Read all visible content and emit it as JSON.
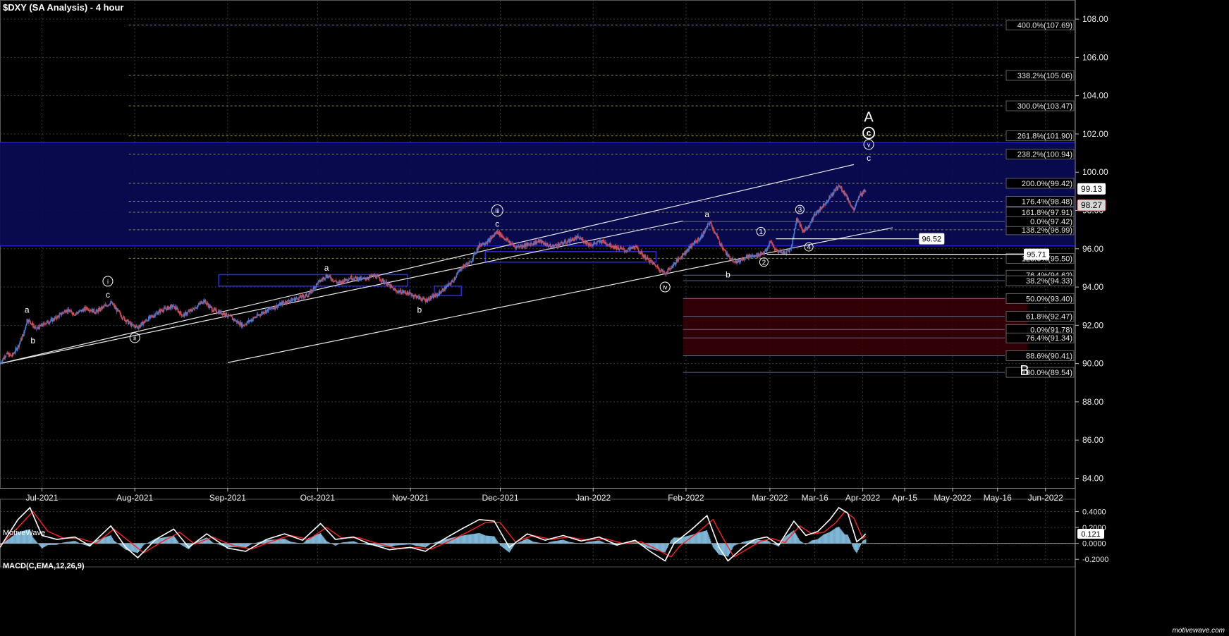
{
  "chart_title": "$DXY (SA Analysis) - 4 hour",
  "brand_label": "MotiveWave",
  "site_label": "motivewave.com",
  "macd_label": "MACD(C,EMA,12,26,9)",
  "colors": {
    "background": "#000000",
    "grid": "#3a3a3a",
    "fib_line": "#8f8f3a",
    "fib_line_lower": "#5a6a8a",
    "channel": "#e8e8e8",
    "zone_blue": "#0a0a55",
    "zone_red": "#3a0008",
    "bull_candle": "#4a7ad8",
    "bear_candle": "#e04848",
    "macd_line": "#ffffff",
    "signal_line": "#ff2020",
    "histogram": "#7fb8d8"
  },
  "chart_data": {
    "type": "candlestick",
    "title": "$DXY (SA Analysis) - 4 hour",
    "ylim": [
      83.5,
      109.0
    ],
    "x_date_range": [
      "2021-06-17",
      "2022-06-10"
    ],
    "x_ticks": [
      {
        "label": "Jul-2021",
        "date": "2021-07-01"
      },
      {
        "label": "Aug-2021",
        "date": "2021-08-01"
      },
      {
        "label": "Sep-2021",
        "date": "2021-09-01"
      },
      {
        "label": "Oct-2021",
        "date": "2021-10-01"
      },
      {
        "label": "Nov-2021",
        "date": "2021-11-01"
      },
      {
        "label": "Dec-2021",
        "date": "2021-12-01"
      },
      {
        "label": "Jan-2022",
        "date": "2022-01-01"
      },
      {
        "label": "Feb-2022",
        "date": "2022-02-01"
      },
      {
        "label": "Mar-2022",
        "date": "2022-03-01"
      },
      {
        "label": "Mar-16",
        "date": "2022-03-16"
      },
      {
        "label": "Apr-2022",
        "date": "2022-04-01"
      },
      {
        "label": "Apr-15",
        "date": "2022-04-15"
      },
      {
        "label": "May-2022",
        "date": "2022-05-01"
      },
      {
        "label": "May-16",
        "date": "2022-05-16"
      },
      {
        "label": "Jun-2022",
        "date": "2022-06-01"
      }
    ],
    "y_ticks": [
      "84.00",
      "86.00",
      "88.00",
      "90.00",
      "92.00",
      "94.00",
      "96.00",
      "98.00",
      "100.00",
      "102.00",
      "104.00",
      "106.00",
      "108.00"
    ],
    "price_path": [
      [
        "2021-06-17",
        90.0
      ],
      [
        "2021-06-19",
        90.5
      ],
      [
        "2021-06-21",
        90.4
      ],
      [
        "2021-06-23",
        90.9
      ],
      [
        "2021-06-25",
        91.6
      ],
      [
        "2021-06-26",
        92.3
      ],
      [
        "2021-06-27",
        92.2
      ],
      [
        "2021-06-29",
        91.8
      ],
      [
        "2021-07-02",
        92.1
      ],
      [
        "2021-07-06",
        92.4
      ],
      [
        "2021-07-09",
        92.8
      ],
      [
        "2021-07-12",
        92.6
      ],
      [
        "2021-07-16",
        92.9
      ],
      [
        "2021-07-19",
        92.7
      ],
      [
        "2021-07-22",
        93.0
      ],
      [
        "2021-07-24",
        93.2
      ],
      [
        "2021-07-28",
        92.4
      ],
      [
        "2021-07-31",
        92.0
      ],
      [
        "2021-08-02",
        91.9
      ],
      [
        "2021-08-06",
        92.4
      ],
      [
        "2021-08-10",
        92.8
      ],
      [
        "2021-08-14",
        93.0
      ],
      [
        "2021-08-17",
        92.5
      ],
      [
        "2021-08-21",
        92.9
      ],
      [
        "2021-08-24",
        93.3
      ],
      [
        "2021-08-27",
        92.8
      ],
      [
        "2021-08-31",
        92.6
      ],
      [
        "2021-09-03",
        92.3
      ],
      [
        "2021-09-06",
        92.0
      ],
      [
        "2021-09-09",
        92.3
      ],
      [
        "2021-09-13",
        92.7
      ],
      [
        "2021-09-16",
        92.9
      ],
      [
        "2021-09-20",
        93.2
      ],
      [
        "2021-09-24",
        93.4
      ],
      [
        "2021-09-28",
        93.6
      ],
      [
        "2021-10-01",
        94.2
      ],
      [
        "2021-10-04",
        94.6
      ],
      [
        "2021-10-08",
        94.2
      ],
      [
        "2021-10-12",
        94.5
      ],
      [
        "2021-10-16",
        94.4
      ],
      [
        "2021-10-20",
        94.6
      ],
      [
        "2021-10-24",
        94.2
      ],
      [
        "2021-10-27",
        93.8
      ],
      [
        "2021-10-31",
        93.7
      ],
      [
        "2021-11-03",
        93.5
      ],
      [
        "2021-11-06",
        93.3
      ],
      [
        "2021-11-10",
        93.6
      ],
      [
        "2021-11-13",
        94.0
      ],
      [
        "2021-11-15",
        94.3
      ],
      [
        "2021-11-18",
        95.0
      ],
      [
        "2021-11-21",
        95.3
      ],
      [
        "2021-11-24",
        96.2
      ],
      [
        "2021-11-27",
        96.4
      ],
      [
        "2021-11-30",
        96.9
      ],
      [
        "2021-12-02",
        96.6
      ],
      [
        "2021-12-06",
        96.1
      ],
      [
        "2021-12-10",
        96.2
      ],
      [
        "2021-12-14",
        96.4
      ],
      [
        "2021-12-18",
        96.1
      ],
      [
        "2021-12-22",
        96.3
      ],
      [
        "2021-12-27",
        96.6
      ],
      [
        "2021-12-31",
        96.2
      ],
      [
        "2022-01-04",
        96.4
      ],
      [
        "2022-01-08",
        96.1
      ],
      [
        "2022-01-12",
        95.9
      ],
      [
        "2022-01-15",
        96.1
      ],
      [
        "2022-01-18",
        95.6
      ],
      [
        "2022-01-22",
        95.1
      ],
      [
        "2022-01-25",
        94.7
      ],
      [
        "2022-01-28",
        95.2
      ],
      [
        "2022-01-31",
        95.7
      ],
      [
        "2022-02-03",
        96.2
      ],
      [
        "2022-02-06",
        96.6
      ],
      [
        "2022-02-09",
        97.4
      ],
      [
        "2022-02-12",
        96.4
      ],
      [
        "2022-02-15",
        95.6
      ],
      [
        "2022-02-18",
        95.3
      ],
      [
        "2022-02-21",
        95.6
      ],
      [
        "2022-02-24",
        95.6
      ],
      [
        "2022-02-28",
        95.9
      ],
      [
        "2022-03-01",
        96.4
      ],
      [
        "2022-03-03",
        95.9
      ],
      [
        "2022-03-06",
        95.8
      ],
      [
        "2022-03-08",
        96.0
      ],
      [
        "2022-03-10",
        97.6
      ],
      [
        "2022-03-12",
        96.9
      ],
      [
        "2022-03-14",
        97.2
      ],
      [
        "2022-03-16",
        97.8
      ],
      [
        "2022-03-19",
        98.3
      ],
      [
        "2022-03-22",
        98.9
      ],
      [
        "2022-03-24",
        99.3
      ],
      [
        "2022-03-26",
        98.9
      ],
      [
        "2022-03-29",
        98.0
      ],
      [
        "2022-03-31",
        98.8
      ],
      [
        "2022-04-02",
        99.13
      ]
    ],
    "fib_levels_upper": [
      {
        "label": "400.0%(107.69)",
        "value": 107.69
      },
      {
        "label": "338.2%(105.06)",
        "value": 105.06
      },
      {
        "label": "300.0%(103.47)",
        "value": 103.47
      },
      {
        "label": "261.8%(101.90)",
        "value": 101.9
      },
      {
        "label": "238.2%(100.94)",
        "value": 100.94
      },
      {
        "label": "200.0%(99.42)",
        "value": 99.42
      },
      {
        "label": "176.4%(98.48)",
        "value": 98.48
      },
      {
        "label": "161.8%(97.91)",
        "value": 97.91
      },
      {
        "label": "138.2%(96.99)",
        "value": 96.99
      },
      {
        "label": "123.6%(95.50)",
        "value": 95.5
      }
    ],
    "fib_levels_lower": [
      {
        "label": "0.0%(97.42)",
        "value": 97.42
      },
      {
        "label": "76.4%(94.62)",
        "value": 94.62
      },
      {
        "label": "38.2%(94.33)",
        "value": 94.33
      },
      {
        "label": "50.0%(93.40)",
        "value": 93.4
      },
      {
        "label": "61.8%(92.47)",
        "value": 92.47
      },
      {
        "label": "0.0%(91.78)",
        "value": 91.78
      },
      {
        "label": "76.4%(91.34)",
        "value": 91.34
      },
      {
        "label": "88.6%(90.41)",
        "value": 90.41
      },
      {
        "label": "100.0%(89.54)",
        "value": 89.54
      }
    ],
    "price_markers": [
      {
        "label": "99.13",
        "value": 99.13,
        "style": "current"
      },
      {
        "label": "98.27",
        "value": 98.27,
        "style": "last"
      }
    ],
    "support_lines": [
      {
        "label": "96.52",
        "value": 96.52,
        "from": "2022-03-03",
        "to": "2022-04-20"
      },
      {
        "label": "95.71",
        "value": 95.71,
        "from": "2022-02-28",
        "to": "2022-05-25"
      }
    ],
    "zones": [
      {
        "kind": "blue",
        "top": 101.55,
        "bottom": 96.15,
        "from": "2021-06-17",
        "to": "2022-06-28"
      },
      {
        "kind": "red",
        "top": 93.45,
        "bottom": 90.45,
        "from": "2022-01-31",
        "to": "2022-05-26"
      }
    ],
    "boxes": [
      {
        "top": 94.65,
        "bottom": 94.05,
        "from": "2021-08-29",
        "to": "2021-10-31"
      },
      {
        "top": 94.05,
        "bottom": 93.55,
        "from": "2021-11-09",
        "to": "2021-11-18"
      },
      {
        "top": 95.85,
        "bottom": 95.3,
        "from": "2021-11-26",
        "to": "2022-01-22"
      }
    ],
    "channels": [
      {
        "from": [
          "2021-06-17",
          90.0
        ],
        "to": [
          "2022-03-29",
          100.4
        ]
      },
      {
        "from": [
          "2021-06-17",
          90.0
        ],
        "to": [
          "2022-01-31",
          97.45
        ]
      },
      {
        "from": [
          "2021-09-01",
          90.05
        ],
        "to": [
          "2022-04-11",
          97.1
        ]
      }
    ],
    "wave_labels": [
      {
        "text": "a",
        "date": "2021-06-26",
        "value": 92.8,
        "style": "plain"
      },
      {
        "text": "b",
        "date": "2021-06-28",
        "value": 91.2,
        "style": "plain"
      },
      {
        "text": "i",
        "date": "2021-07-23",
        "value": 94.3,
        "style": "roman-circle"
      },
      {
        "text": "c",
        "date": "2021-07-23",
        "value": 93.6,
        "style": "plain"
      },
      {
        "text": "ii",
        "date": "2021-08-01",
        "value": 91.35,
        "style": "roman-circle"
      },
      {
        "text": "a",
        "date": "2021-10-04",
        "value": 95.0,
        "style": "plain"
      },
      {
        "text": "b",
        "date": "2021-11-04",
        "value": 92.8,
        "style": "plain"
      },
      {
        "text": "iii",
        "date": "2021-11-30",
        "value": 98.0,
        "style": "roman-circle"
      },
      {
        "text": "c",
        "date": "2021-11-30",
        "value": 97.3,
        "style": "plain"
      },
      {
        "text": "iv",
        "date": "2022-01-25",
        "value": 94.0,
        "style": "roman-circle"
      },
      {
        "text": "a",
        "date": "2022-02-08",
        "value": 97.8,
        "style": "plain"
      },
      {
        "text": "b",
        "date": "2022-02-15",
        "value": 94.65,
        "style": "plain"
      },
      {
        "text": "1",
        "date": "2022-02-26",
        "value": 96.9,
        "style": "circle"
      },
      {
        "text": "2",
        "date": "2022-02-27",
        "value": 95.3,
        "style": "circle"
      },
      {
        "text": "3",
        "date": "2022-03-11",
        "value": 98.05,
        "style": "circle"
      },
      {
        "text": "4",
        "date": "2022-03-14",
        "value": 96.1,
        "style": "circle"
      },
      {
        "text": "A",
        "date": "2022-04-03",
        "value": 102.9,
        "style": "large"
      },
      {
        "text": "c",
        "date": "2022-04-03",
        "value": 102.05,
        "style": "circle-bold"
      },
      {
        "text": "v",
        "date": "2022-04-03",
        "value": 101.45,
        "style": "roman-circle"
      },
      {
        "text": "c",
        "date": "2022-04-03",
        "value": 100.75,
        "style": "plain"
      },
      {
        "text": "B",
        "date": "2022-05-25",
        "value": 89.65,
        "style": "large"
      }
    ]
  },
  "macd_data": {
    "ylim": [
      -0.26,
      0.52
    ],
    "y_ticks": [
      {
        "label": "0.4000",
        "value": 0.4
      },
      {
        "label": "0.2000",
        "value": 0.2
      },
      {
        "label": "0.0000",
        "value": 0.0
      },
      {
        "label": "-0.2000",
        "value": -0.2
      }
    ],
    "current": {
      "label": "0.121",
      "value": 0.121
    },
    "macd": [
      [
        "2021-06-17",
        -0.05
      ],
      [
        "2021-06-23",
        0.3
      ],
      [
        "2021-06-27",
        0.45
      ],
      [
        "2021-07-01",
        0.1
      ],
      [
        "2021-07-06",
        0.05
      ],
      [
        "2021-07-12",
        0.08
      ],
      [
        "2021-07-17",
        -0.03
      ],
      [
        "2021-07-24",
        0.22
      ],
      [
        "2021-07-29",
        -0.05
      ],
      [
        "2021-08-02",
        -0.18
      ],
      [
        "2021-08-08",
        0.05
      ],
      [
        "2021-08-14",
        0.18
      ],
      [
        "2021-08-19",
        -0.05
      ],
      [
        "2021-08-25",
        0.12
      ],
      [
        "2021-09-01",
        -0.06
      ],
      [
        "2021-09-07",
        -0.1
      ],
      [
        "2021-09-14",
        0.05
      ],
      [
        "2021-09-20",
        0.12
      ],
      [
        "2021-09-26",
        0.04
      ],
      [
        "2021-10-02",
        0.25
      ],
      [
        "2021-10-07",
        0.05
      ],
      [
        "2021-10-13",
        0.08
      ],
      [
        "2021-10-18",
        0.0
      ],
      [
        "2021-10-25",
        -0.08
      ],
      [
        "2021-11-01",
        -0.05
      ],
      [
        "2021-11-06",
        -0.1
      ],
      [
        "2021-11-12",
        0.05
      ],
      [
        "2021-11-18",
        0.18
      ],
      [
        "2021-11-24",
        0.3
      ],
      [
        "2021-11-29",
        0.28
      ],
      [
        "2021-12-04",
        -0.05
      ],
      [
        "2021-12-10",
        0.12
      ],
      [
        "2021-12-16",
        0.04
      ],
      [
        "2021-12-22",
        0.1
      ],
      [
        "2021-12-28",
        0.03
      ],
      [
        "2022-01-03",
        0.08
      ],
      [
        "2022-01-09",
        -0.02
      ],
      [
        "2022-01-15",
        0.04
      ],
      [
        "2022-01-20",
        -0.1
      ],
      [
        "2022-01-25",
        -0.22
      ],
      [
        "2022-01-28",
        0.0
      ],
      [
        "2022-02-03",
        0.18
      ],
      [
        "2022-02-08",
        0.35
      ],
      [
        "2022-02-12",
        -0.05
      ],
      [
        "2022-02-15",
        -0.22
      ],
      [
        "2022-02-20",
        -0.05
      ],
      [
        "2022-02-24",
        0.05
      ],
      [
        "2022-02-28",
        0.08
      ],
      [
        "2022-03-04",
        -0.02
      ],
      [
        "2022-03-09",
        0.28
      ],
      [
        "2022-03-13",
        0.1
      ],
      [
        "2022-03-17",
        0.15
      ],
      [
        "2022-03-21",
        0.3
      ],
      [
        "2022-03-24",
        0.45
      ],
      [
        "2022-03-27",
        0.38
      ],
      [
        "2022-03-30",
        0.02
      ],
      [
        "2022-04-01",
        0.08
      ],
      [
        "2022-04-02",
        0.121
      ]
    ],
    "signal": [
      [
        "2021-06-17",
        -0.03
      ],
      [
        "2021-06-23",
        0.2
      ],
      [
        "2021-06-28",
        0.4
      ],
      [
        "2021-07-03",
        0.15
      ],
      [
        "2021-07-08",
        0.07
      ],
      [
        "2021-07-14",
        0.06
      ],
      [
        "2021-07-19",
        0.0
      ],
      [
        "2021-07-25",
        0.18
      ],
      [
        "2021-07-31",
        0.0
      ],
      [
        "2021-08-04",
        -0.12
      ],
      [
        "2021-08-10",
        0.02
      ],
      [
        "2021-08-16",
        0.14
      ],
      [
        "2021-08-21",
        -0.01
      ],
      [
        "2021-08-27",
        0.08
      ],
      [
        "2021-09-03",
        -0.03
      ],
      [
        "2021-09-09",
        -0.07
      ],
      [
        "2021-09-16",
        0.03
      ],
      [
        "2021-09-22",
        0.1
      ],
      [
        "2021-09-28",
        0.05
      ],
      [
        "2021-10-04",
        0.2
      ],
      [
        "2021-10-09",
        0.07
      ],
      [
        "2021-10-15",
        0.07
      ],
      [
        "2021-10-20",
        0.01
      ],
      [
        "2021-10-27",
        -0.06
      ],
      [
        "2021-11-03",
        -0.05
      ],
      [
        "2021-11-08",
        -0.07
      ],
      [
        "2021-11-14",
        0.03
      ],
      [
        "2021-11-20",
        0.14
      ],
      [
        "2021-11-26",
        0.26
      ],
      [
        "2021-12-01",
        0.26
      ],
      [
        "2021-12-06",
        0.02
      ],
      [
        "2021-12-12",
        0.1
      ],
      [
        "2021-12-18",
        0.05
      ],
      [
        "2021-12-24",
        0.08
      ],
      [
        "2021-12-30",
        0.04
      ],
      [
        "2022-01-05",
        0.06
      ],
      [
        "2022-01-11",
        0.0
      ],
      [
        "2022-01-17",
        0.02
      ],
      [
        "2022-01-22",
        -0.07
      ],
      [
        "2022-01-27",
        -0.17
      ],
      [
        "2022-01-30",
        -0.03
      ],
      [
        "2022-02-05",
        0.14
      ],
      [
        "2022-02-10",
        0.3
      ],
      [
        "2022-02-14",
        0.02
      ],
      [
        "2022-02-17",
        -0.17
      ],
      [
        "2022-02-22",
        -0.06
      ],
      [
        "2022-02-26",
        0.03
      ],
      [
        "2022-03-02",
        0.06
      ],
      [
        "2022-03-06",
        0.01
      ],
      [
        "2022-03-11",
        0.22
      ],
      [
        "2022-03-15",
        0.12
      ],
      [
        "2022-03-19",
        0.14
      ],
      [
        "2022-03-23",
        0.26
      ],
      [
        "2022-03-26",
        0.4
      ],
      [
        "2022-03-29",
        0.32
      ],
      [
        "2022-04-01",
        0.06
      ],
      [
        "2022-04-02",
        0.09
      ]
    ]
  }
}
